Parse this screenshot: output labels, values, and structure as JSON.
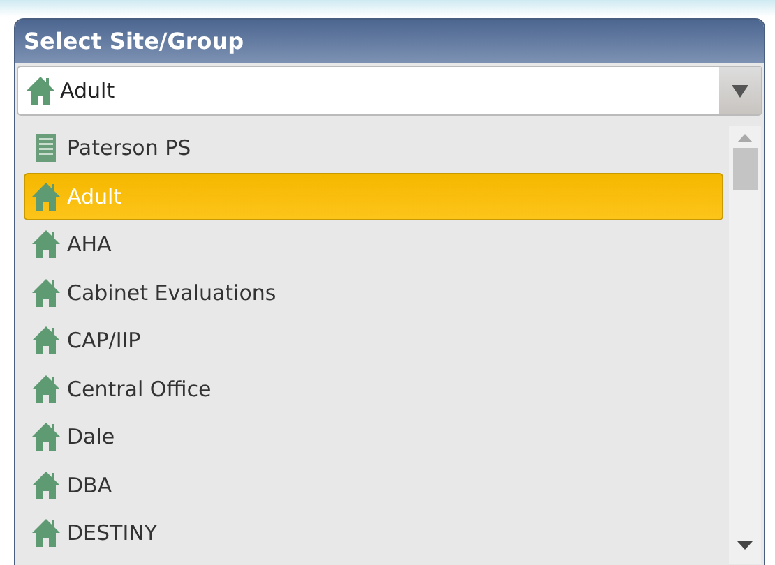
{
  "panel": {
    "title": "Select Site/Group"
  },
  "combo": {
    "value": "Adult",
    "kind": "house"
  },
  "items": [
    {
      "label": "Paterson PS",
      "kind": "building",
      "selected": false
    },
    {
      "label": "Adult",
      "kind": "house",
      "selected": true
    },
    {
      "label": "AHA",
      "kind": "house",
      "selected": false
    },
    {
      "label": "Cabinet Evaluations",
      "kind": "house",
      "selected": false
    },
    {
      "label": "CAP/IIP",
      "kind": "house",
      "selected": false
    },
    {
      "label": "Central Office",
      "kind": "house",
      "selected": false
    },
    {
      "label": "Dale",
      "kind": "house",
      "selected": false
    },
    {
      "label": "DBA",
      "kind": "house",
      "selected": false
    },
    {
      "label": "DESTINY",
      "kind": "house",
      "selected": false
    }
  ]
}
